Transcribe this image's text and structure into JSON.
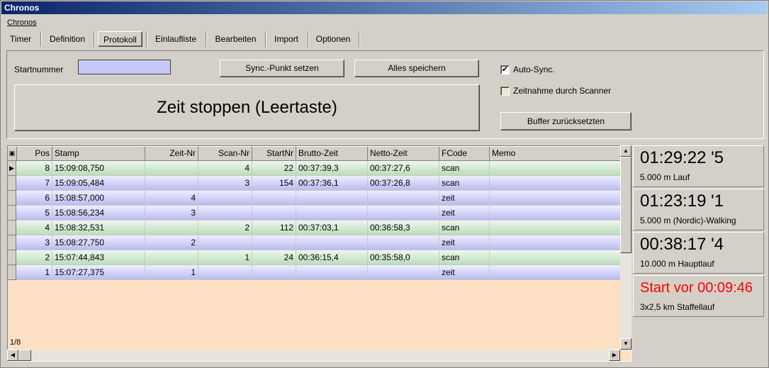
{
  "window": {
    "title": "Chronos"
  },
  "menu": {
    "items": [
      "Chronos"
    ]
  },
  "tabs": [
    "Timer",
    "Definition",
    "Protokoll",
    "Einlaufliste",
    "Bearbeiten",
    "Import",
    "Optionen"
  ],
  "active_tab": "Protokoll",
  "form": {
    "startnummer_label": "Startnummer",
    "startnummer_value": "",
    "sync_button": "Sync.-Punkt setzen",
    "save_button": "Alles speichern",
    "stop_button": "Zeit stoppen (Leertaste)",
    "autosync_label": "Auto-Sync.",
    "autosync_checked": true,
    "scanner_label": "Zeitnahme durch Scanner",
    "scanner_checked": false,
    "buffer_button": "Buffer zurücksetzten"
  },
  "table": {
    "columns": [
      "Pos",
      "Stamp",
      "Zeit-Nr",
      "Scan-Nr",
      "StartNr",
      "Brutto-Zeit",
      "Netto-Zeit",
      "FCode",
      "Memo"
    ],
    "rows": [
      {
        "pos": "8",
        "stamp": "15:09:08,750",
        "zeit_nr": "",
        "scan_nr": "4",
        "start_nr": "22",
        "brutto": "00:37:39,3",
        "netto": "00:37:27,6",
        "fcode": "scan",
        "memo": "",
        "color": "green"
      },
      {
        "pos": "7",
        "stamp": "15:09:05,484",
        "zeit_nr": "",
        "scan_nr": "3",
        "start_nr": "154",
        "brutto": "00:37:36,1",
        "netto": "00:37:26,8",
        "fcode": "scan",
        "memo": "",
        "color": "blue"
      },
      {
        "pos": "6",
        "stamp": "15:08:57,000",
        "zeit_nr": "4",
        "scan_nr": "",
        "start_nr": "",
        "brutto": "",
        "netto": "",
        "fcode": "zeit",
        "memo": "",
        "color": "blue"
      },
      {
        "pos": "5",
        "stamp": "15:08:56,234",
        "zeit_nr": "3",
        "scan_nr": "",
        "start_nr": "",
        "brutto": "",
        "netto": "",
        "fcode": "zeit",
        "memo": "",
        "color": "blue"
      },
      {
        "pos": "4",
        "stamp": "15:08:32,531",
        "zeit_nr": "",
        "scan_nr": "2",
        "start_nr": "112",
        "brutto": "00:37:03,1",
        "netto": "00:36:58,3",
        "fcode": "scan",
        "memo": "",
        "color": "green"
      },
      {
        "pos": "3",
        "stamp": "15:08:27,750",
        "zeit_nr": "2",
        "scan_nr": "",
        "start_nr": "",
        "brutto": "",
        "netto": "",
        "fcode": "zeit",
        "memo": "",
        "color": "blue"
      },
      {
        "pos": "2",
        "stamp": "15:07:44,843",
        "zeit_nr": "",
        "scan_nr": "1",
        "start_nr": "24",
        "brutto": "00:36:15,4",
        "netto": "00:35:58,0",
        "fcode": "scan",
        "memo": "",
        "color": "green"
      },
      {
        "pos": "1",
        "stamp": "15:07:27,375",
        "zeit_nr": "1",
        "scan_nr": "",
        "start_nr": "",
        "brutto": "",
        "netto": "",
        "fcode": "zeit",
        "memo": "",
        "color": "blue"
      }
    ],
    "record_counter": "1/8"
  },
  "races": [
    {
      "time": "01:29:22 '5",
      "name": "5.000 m Lauf",
      "color": "#000000"
    },
    {
      "time": "01:23:19 '1",
      "name": "5.000 m (Nordic)-Walking",
      "color": "#000000"
    },
    {
      "time": "00:38:17 '4",
      "name": "10.000 m Hauptlauf",
      "color": "#000000"
    },
    {
      "time": "Start vor 00:09:46",
      "name": "3x2,5 km Staffellauf",
      "color": "#ff0000"
    }
  ],
  "colors": {
    "row_green": "#b8dcb8",
    "row_blue": "#b8b8f0",
    "grid_bg": "#fde0c4",
    "input_bg": "#c8c8f8"
  }
}
